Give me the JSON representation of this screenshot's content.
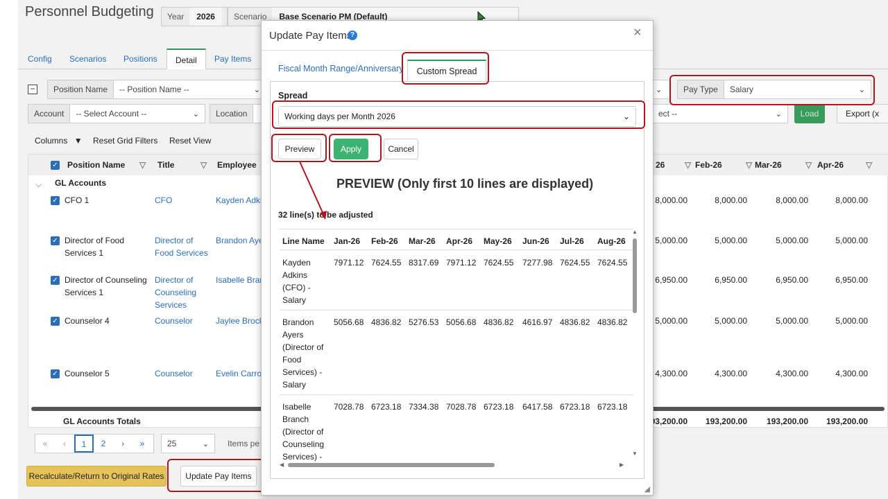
{
  "app": {
    "title": "Personnel Budgeting",
    "year_label": "Year",
    "year_value": "2026",
    "scenario_label": "Scenario",
    "scenario_value": "Base Scenario PM (Default)"
  },
  "tabs": [
    "Config",
    "Scenarios",
    "Positions",
    "Detail",
    "Pay Items"
  ],
  "filters": {
    "position_name_label": "Position Name",
    "position_name_value": "-- Position Name --",
    "account_label": "Account",
    "account_value": "-- Select Account --",
    "location_label": "Location",
    "pay_type_label": "Pay Type",
    "pay_type_value": "Salary",
    "select_value": "ect --",
    "load_label": "Load",
    "export_label": "Export (x"
  },
  "toolbar": {
    "columns_label": "Columns",
    "reset_filters_label": "Reset Grid Filters",
    "reset_view_label": "Reset View"
  },
  "grid": {
    "headers": {
      "position": "Position Name",
      "title": "Title",
      "employee": "Employee"
    },
    "month_headers": [
      "26",
      "Feb-26",
      "Mar-26",
      "Apr-26"
    ],
    "group_label": "GL Accounts",
    "rows": [
      {
        "position": "CFO 1",
        "title": "CFO",
        "employee": "Kayden Adkir",
        "vals": [
          "8,000.00",
          "8,000.00",
          "8,000.00",
          "8,000.00"
        ]
      },
      {
        "position": "Director of Food Services 1",
        "title": "Director of Food Services",
        "employee": "Brandon Ayer",
        "vals": [
          "5,000.00",
          "5,000.00",
          "5,000.00",
          "5,000.00"
        ]
      },
      {
        "position": "Director of Counseling Services 1",
        "title": "Director of Counseling Services",
        "employee": "Isabelle Bran",
        "vals": [
          "6,950.00",
          "6,950.00",
          "6,950.00",
          "6,950.00"
        ]
      },
      {
        "position": "Counselor 4",
        "title": "Counselor",
        "employee": "Jaylee Brock",
        "vals": [
          "5,000.00",
          "5,000.00",
          "5,000.00",
          "5,000.00"
        ]
      },
      {
        "position": "Counselor 5",
        "title": "Counselor",
        "employee": "Evelin Carroll",
        "vals": [
          "4,300.00",
          "4,300.00",
          "4,300.00",
          "4,300.00"
        ]
      }
    ],
    "totals_label": "GL Accounts Totals",
    "totals": [
      "193,200.00",
      "193,200.00",
      "193,200.00",
      "193,200.00"
    ]
  },
  "pager": {
    "first": "«",
    "prev": "‹",
    "page1": "1",
    "page2": "2",
    "next": "›",
    "last": "»",
    "page_size": "25",
    "items_label": "Items pe"
  },
  "footer": {
    "recalc_label": "Recalculate/Return to Original Rates",
    "update_label": "Update Pay Items"
  },
  "modal": {
    "title": "Update Pay Items",
    "help_glyph": "?",
    "close_glyph": "×",
    "tab_fiscal": "Fiscal Month Range/Anniversary",
    "tab_custom": "Custom Spread",
    "spread_label": "Spread",
    "spread_value": "Working days per Month 2026",
    "preview_btn": "Preview",
    "apply_btn": "Apply",
    "cancel_btn": "Cancel",
    "preview_heading": "PREVIEW (Only first 10 lines are displayed)",
    "lines_count": "32 line(s) to be adjusted",
    "table_headers": [
      "Line Name",
      "Jan-26",
      "Feb-26",
      "Mar-26",
      "Apr-26",
      "May-26",
      "Jun-26",
      "Jul-26",
      "Aug-26"
    ],
    "table_rows": [
      {
        "name": "Kayden Adkins (CFO) - Salary",
        "vals": [
          "7971.12",
          "7624.55",
          "8317.69",
          "7971.12",
          "7624.55",
          "7277.98",
          "7624.55",
          "7624.55"
        ]
      },
      {
        "name": "Brandon Ayers (Director of Food Services) - Salary",
        "vals": [
          "5056.68",
          "4836.82",
          "5276.53",
          "5056.68",
          "4836.82",
          "4616.97",
          "4836.82",
          "4836.82"
        ]
      },
      {
        "name": "Isabelle Branch (Director of Counseling Services) -",
        "vals": [
          "7028.78",
          "6723.18",
          "7334.38",
          "7028.78",
          "6723.18",
          "6417.58",
          "6723.18",
          "6723.18"
        ]
      }
    ]
  },
  "colors": {
    "accent_link": "#2a6eb8",
    "highlight": "#b0141e",
    "apply_green": "#3cb371",
    "load_green": "#3a9a5c"
  }
}
